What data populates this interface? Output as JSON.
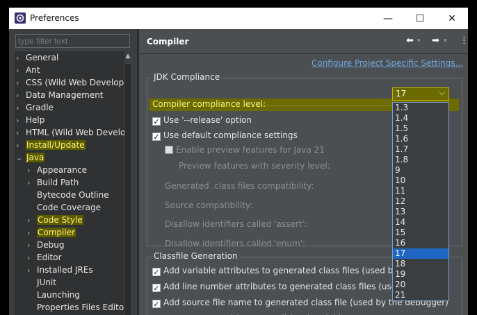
{
  "window": {
    "title": "Preferences",
    "minimize_glyph": "—",
    "maximize_glyph": "☐",
    "close_glyph": "✕"
  },
  "filter": {
    "placeholder": "type filter text"
  },
  "tree": [
    {
      "label": "General",
      "chevron": ">",
      "highlight": false
    },
    {
      "label": "Ant",
      "chevron": ">",
      "highlight": false
    },
    {
      "label": "CSS (Wild Web Develop",
      "chevron": ">",
      "highlight": false
    },
    {
      "label": "Data Management",
      "chevron": ">",
      "highlight": false
    },
    {
      "label": "Gradle",
      "chevron": ">",
      "highlight": false
    },
    {
      "label": "Help",
      "chevron": ">",
      "highlight": false
    },
    {
      "label": "HTML (Wild Web Develo",
      "chevron": ">",
      "highlight": false
    },
    {
      "label": "Install/Update",
      "chevron": ">",
      "highlight": true
    },
    {
      "label": "Java",
      "chevron": "v",
      "highlight": true
    },
    {
      "label": "Appearance",
      "chevron": ">",
      "highlight": false
    },
    {
      "label": "Build Path",
      "chevron": ">",
      "highlight": false
    },
    {
      "label": "Bytecode Outline",
      "chevron": "",
      "highlight": false
    },
    {
      "label": "Code Coverage",
      "chevron": "",
      "highlight": false
    },
    {
      "label": "Code Style",
      "chevron": ">",
      "highlight": true
    },
    {
      "label": "Compiler",
      "chevron": ">",
      "highlight": true
    },
    {
      "label": "Debug",
      "chevron": ">",
      "highlight": false
    },
    {
      "label": "Editor",
      "chevron": ">",
      "highlight": false
    },
    {
      "label": "Installed JREs",
      "chevron": ">",
      "highlight": false
    },
    {
      "label": "JUnit",
      "chevron": "",
      "highlight": false
    },
    {
      "label": "Launching",
      "chevron": "",
      "highlight": false
    },
    {
      "label": "Properties Files Edito",
      "chevron": "",
      "highlight": false
    }
  ],
  "page": {
    "title": "Compiler",
    "back_glyph": "⬅",
    "forward_glyph": "➡",
    "menu_glyph": "⋮",
    "dropdown_glyph": "▾",
    "config_link": "Configure Project Specific Settings..."
  },
  "jdk": {
    "legend": "JDK Compliance",
    "compliance_label": "Compiler compliance level:",
    "compliance_value": "17",
    "release_label": "Use '--release' option",
    "release_checked": true,
    "default_label": "Use default compliance settings",
    "default_checked": true,
    "preview_enable_label": "Enable preview features for Java 21",
    "preview_severity_label": "Preview features with severity level:",
    "generated_label": "Generated .class files compatibility:",
    "source_label": "Source compatibility:",
    "assert_label": "Disallow identifiers called 'assert':",
    "enum_label": "Disallow identifiers called 'enum':",
    "options": [
      "1.3",
      "1.4",
      "1.5",
      "1.6",
      "1.7",
      "1.8",
      "9",
      "10",
      "11",
      "12",
      "13",
      "14",
      "15",
      "16",
      "17",
      "18",
      "19",
      "20",
      "21"
    ],
    "selected": "17"
  },
  "classfile": {
    "legend": "Classfile Generation",
    "items": [
      {
        "label": "Add variable attributes to generated class files (used by the debu",
        "checked": true
      },
      {
        "label": "Add line number attributes to generated class files (used by the de",
        "checked": true
      },
      {
        "label": "Add source file name to generated class file (used by the debugger)",
        "checked": true
      },
      {
        "label": "Preserve unused (never read) local variables",
        "checked": true
      }
    ]
  }
}
